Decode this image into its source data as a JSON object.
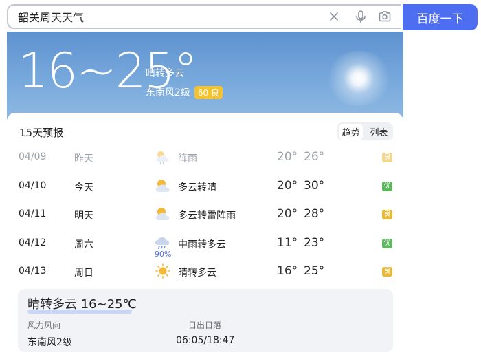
{
  "search": {
    "query": "韶关周天天气",
    "button_label": "百度一下"
  },
  "weather": {
    "temp_range_big": "16~25°",
    "condition": "晴转多云",
    "wind": "东南风2级",
    "aqi": {
      "value": "60",
      "level": "良",
      "color": "#f2c230"
    },
    "forecast_title": "15天预报",
    "view_toggle": [
      "趋势",
      "列表"
    ],
    "days": [
      {
        "date": "04/09",
        "day": "昨天",
        "icon": "sun-cloud-rain-icon",
        "cond": "阵雨",
        "low": "20°",
        "high": "26°",
        "aq": "良",
        "aq_color": "#e8b838",
        "past": true
      },
      {
        "date": "04/10",
        "day": "今天",
        "icon": "sun-cloud-icon",
        "cond": "多云转晴",
        "low": "20°",
        "high": "30°",
        "aq": "优",
        "aq_color": "#5cb85c",
        "past": false
      },
      {
        "date": "04/11",
        "day": "明天",
        "icon": "sun-cloud-icon",
        "cond": "多云转雷阵雨",
        "low": "20°",
        "high": "28°",
        "aq": "良",
        "aq_color": "#e8b838",
        "past": false
      },
      {
        "date": "04/12",
        "day": "周六",
        "icon": "rain-cloud-icon",
        "cond": "中雨转多云",
        "precip": "90%",
        "low": "11°",
        "high": "23°",
        "aq": "优",
        "aq_color": "#5cb85c",
        "past": false
      },
      {
        "date": "04/13",
        "day": "周日",
        "icon": "sun-icon",
        "cond": "晴转多云",
        "low": "16°",
        "high": "25°",
        "aq": "良",
        "aq_color": "#e8b838",
        "past": false
      }
    ],
    "detail": {
      "title": "晴转多云 16~25℃",
      "wind_label": "风力风向",
      "wind_value": "东南风2级",
      "sun_label": "日出日落",
      "sun_value": "06:05/18:47"
    }
  }
}
